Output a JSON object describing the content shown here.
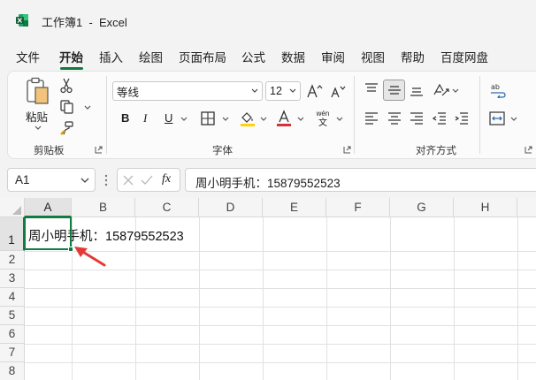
{
  "window": {
    "title": "工作簿1  -  Excel"
  },
  "tabs": [
    "文件",
    "开始",
    "插入",
    "绘图",
    "页面布局",
    "公式",
    "数据",
    "审阅",
    "视图",
    "帮助",
    "百度网盘"
  ],
  "active_tab": "开始",
  "ribbon": {
    "clipboard": {
      "paste_label": "粘贴",
      "group_label": "剪贴板"
    },
    "font": {
      "font_name": "等线",
      "font_size": "12",
      "group_label": "字体",
      "bold": "B",
      "italic": "I",
      "underline": "U",
      "phonetic_top": "wén",
      "phonetic_bottom": "文"
    },
    "alignment": {
      "group_label": "对齐方式"
    }
  },
  "formula_bar": {
    "name_box": "A1",
    "fx": "fx",
    "content": "周小明手机：15879552523"
  },
  "grid": {
    "columns": [
      "A",
      "B",
      "C",
      "D",
      "E",
      "F",
      "G",
      "H"
    ],
    "rows": [
      "1",
      "2",
      "3",
      "4",
      "5",
      "6",
      "7",
      "8"
    ],
    "selected_cell": "A1",
    "cells": {
      "A1": "周小明手机：15879552523"
    }
  },
  "colors": {
    "accent": "#107c41",
    "arrow": "#e53935",
    "font_color_bar": "#d13438",
    "fill_color_bar": "#ffd400"
  }
}
